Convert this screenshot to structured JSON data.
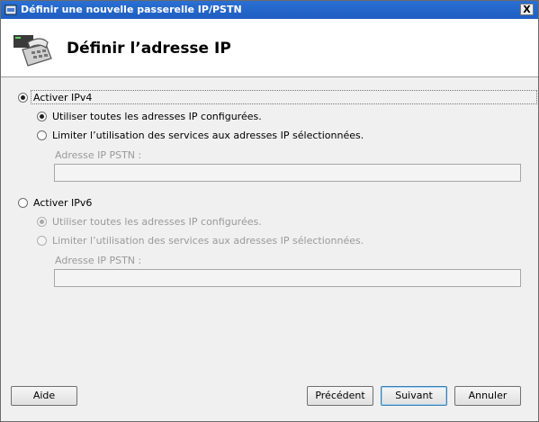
{
  "window": {
    "title": "Définir une nouvelle passerelle IP/PSTN",
    "close_glyph": "X"
  },
  "header": {
    "title": "Définir l’adresse IP",
    "icon": "gateway-phone-icon"
  },
  "ipv4": {
    "label": "Activer IPv4",
    "checked": true,
    "use_all": "Utiliser toutes les adresses IP configurées.",
    "limit": "Limiter l’utilisation des services aux adresses IP sélectionnées.",
    "field_label": "Adresse IP PSTN :",
    "field_value": ""
  },
  "ipv6": {
    "label": "Activer IPv6",
    "checked": false,
    "use_all": "Utiliser toutes les adresses IP configurées.",
    "limit": "Limiter l’utilisation des services aux adresses IP sélectionnées.",
    "field_label": "Adresse IP PSTN :",
    "field_value": ""
  },
  "buttons": {
    "help": "Aide",
    "previous": "Précédent",
    "next": "Suivant",
    "cancel": "Annuler"
  }
}
